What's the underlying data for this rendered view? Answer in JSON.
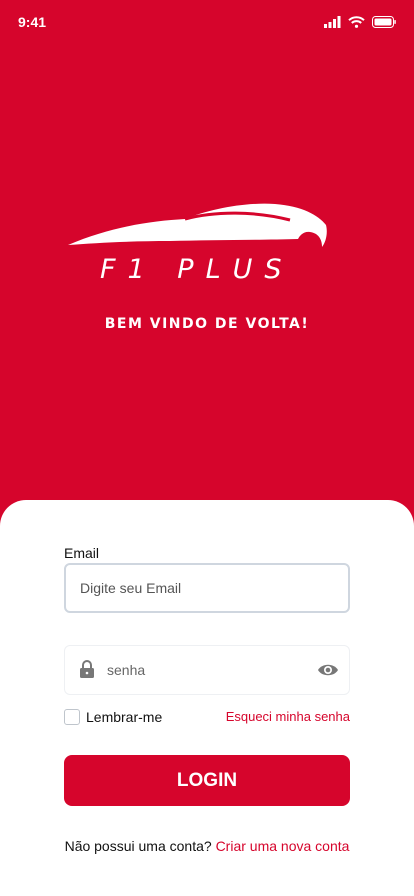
{
  "status": {
    "time": "9:41"
  },
  "brand": {
    "logo_text": "F1 PLUS",
    "welcome": "BEM VINDO DE VOLTA!"
  },
  "form": {
    "email_label": "Email",
    "email_placeholder": "Digite seu Email",
    "password_placeholder": "senha",
    "remember_label": "Lembrar-me",
    "forgot_label": "Esqueci minha senha",
    "login_label": "LOGIN"
  },
  "footer": {
    "question": "Não possui uma conta?",
    "signup_link": "Criar uma nova conta"
  },
  "colors": {
    "brand_red": "#d6052c",
    "card_bg": "#ffffff"
  }
}
